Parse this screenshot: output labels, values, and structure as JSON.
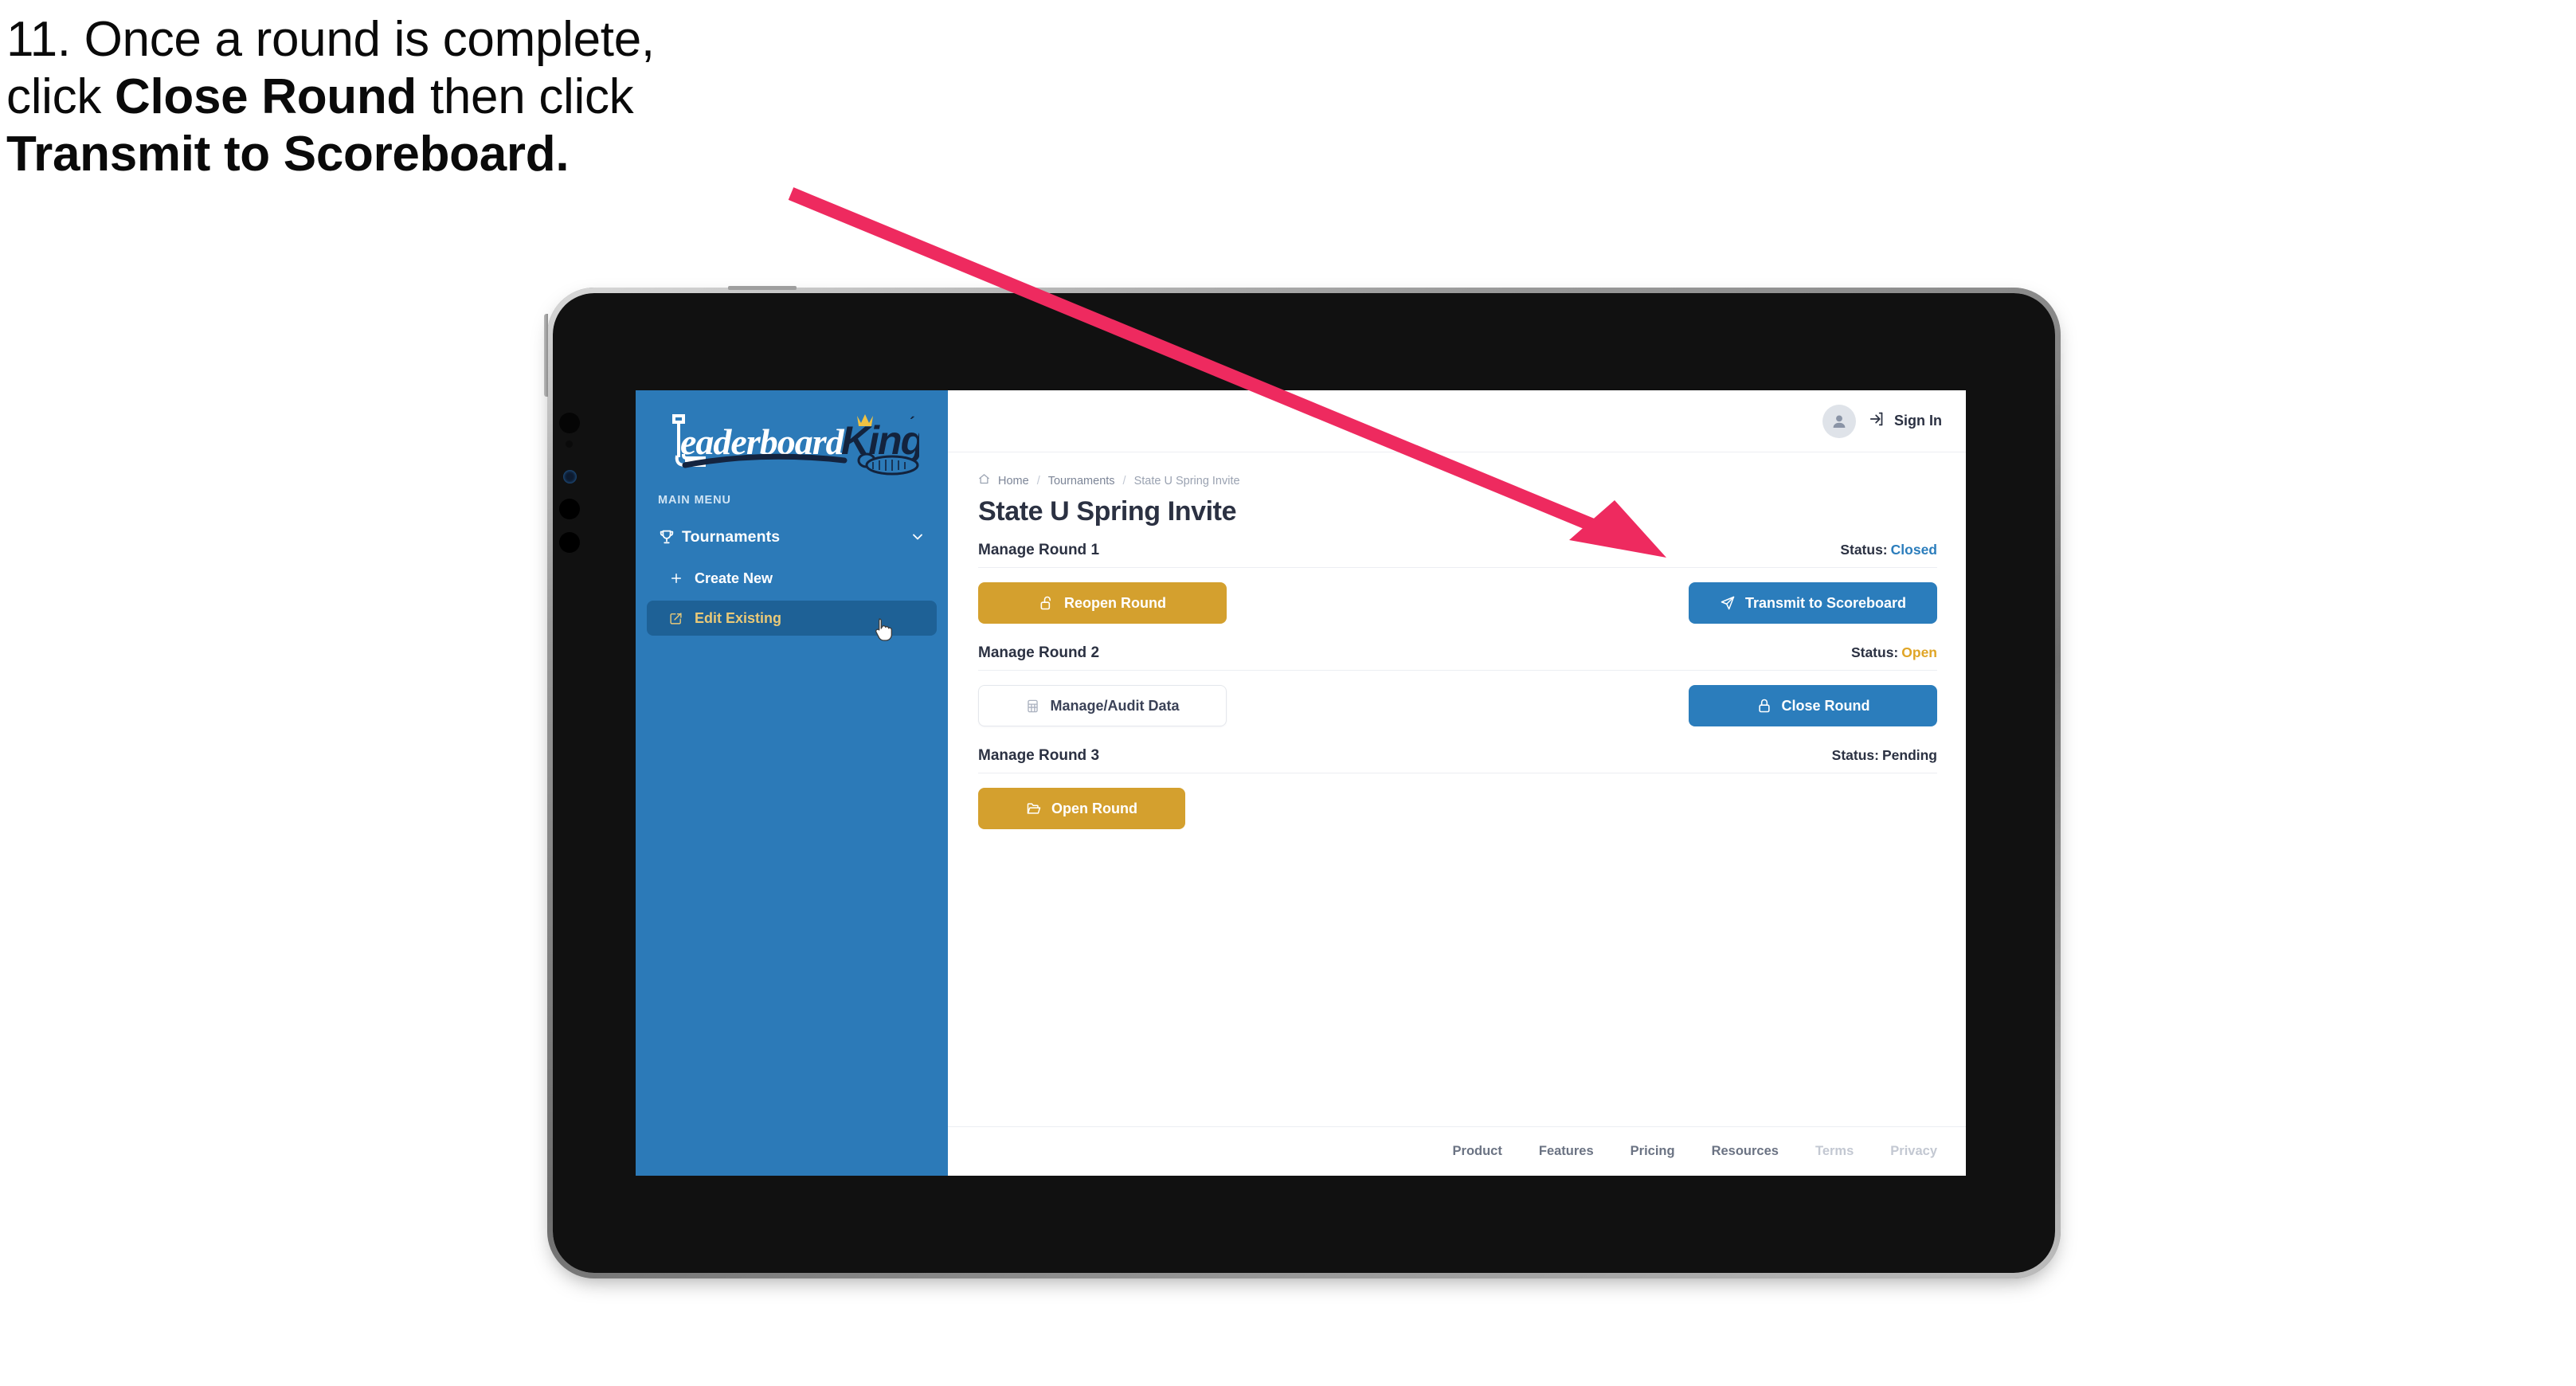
{
  "caption": {
    "line1": "11. Once a round is complete,",
    "line2_pre": "click ",
    "line2_bold": "Close Round",
    "line2_post": " then click",
    "line3_bold": "Transmit to Scoreboard."
  },
  "colors": {
    "sidebar_blue": "#2C7AB8",
    "sidebar_active": "#1E6196",
    "accent_gold": "#D4A02E",
    "accent_blue": "#2B7DBC",
    "arrow_pink": "#EE2A5F",
    "text_dark": "#2B3142",
    "status_open": "#E0A526",
    "status_closed": "#2B7DBC"
  },
  "sidebar": {
    "logo_primary": "Leaderboard",
    "logo_secondary": "King",
    "section_label": "MAIN MENU",
    "items": [
      {
        "label": "Tournaments",
        "icon": "trophy-icon",
        "expanded": true
      },
      {
        "label": "Create New",
        "icon": "plus-icon",
        "active": false
      },
      {
        "label": "Edit Existing",
        "icon": "edit-square-icon",
        "active": true
      }
    ]
  },
  "topbar": {
    "avatar_icon": "user-avatar-icon",
    "signin_icon": "sign-in-arrow-icon",
    "signin_label": "Sign In"
  },
  "breadcrumb": {
    "home_icon": "home-icon",
    "items": [
      "Home",
      "Tournaments",
      "State U Spring Invite"
    ],
    "separator": "/"
  },
  "page": {
    "title": "State U Spring Invite"
  },
  "rounds": [
    {
      "title": "Manage Round 1",
      "status_label": "Status:",
      "status_value": "Closed",
      "status_kind": "closed",
      "left_button": {
        "label": "Reopen Round",
        "style": "gold",
        "icon": "unlock-icon"
      },
      "right_button": {
        "label": "Transmit to Scoreboard",
        "style": "blue",
        "icon": "paper-plane-icon"
      }
    },
    {
      "title": "Manage Round 2",
      "status_label": "Status:",
      "status_value": "Open",
      "status_kind": "open",
      "left_button": {
        "label": "Manage/Audit Data",
        "style": "ghost",
        "icon": "table-grid-icon"
      },
      "right_button": {
        "label": "Close Round",
        "style": "blue",
        "icon": "lock-icon"
      }
    },
    {
      "title": "Manage Round 3",
      "status_label": "Status:",
      "status_value": "Pending",
      "status_kind": "pending",
      "left_button": {
        "label": "Open Round",
        "style": "gold",
        "icon": "folder-open-icon"
      },
      "right_button": null
    }
  ],
  "footer": {
    "links": [
      {
        "label": "Product",
        "muted": false
      },
      {
        "label": "Features",
        "muted": false
      },
      {
        "label": "Pricing",
        "muted": false
      },
      {
        "label": "Resources",
        "muted": false
      },
      {
        "label": "Terms",
        "muted": true
      },
      {
        "label": "Privacy",
        "muted": true
      }
    ]
  },
  "annotation": {
    "arrow": "pink-callout-arrow",
    "points_to": "Transmit to Scoreboard"
  }
}
